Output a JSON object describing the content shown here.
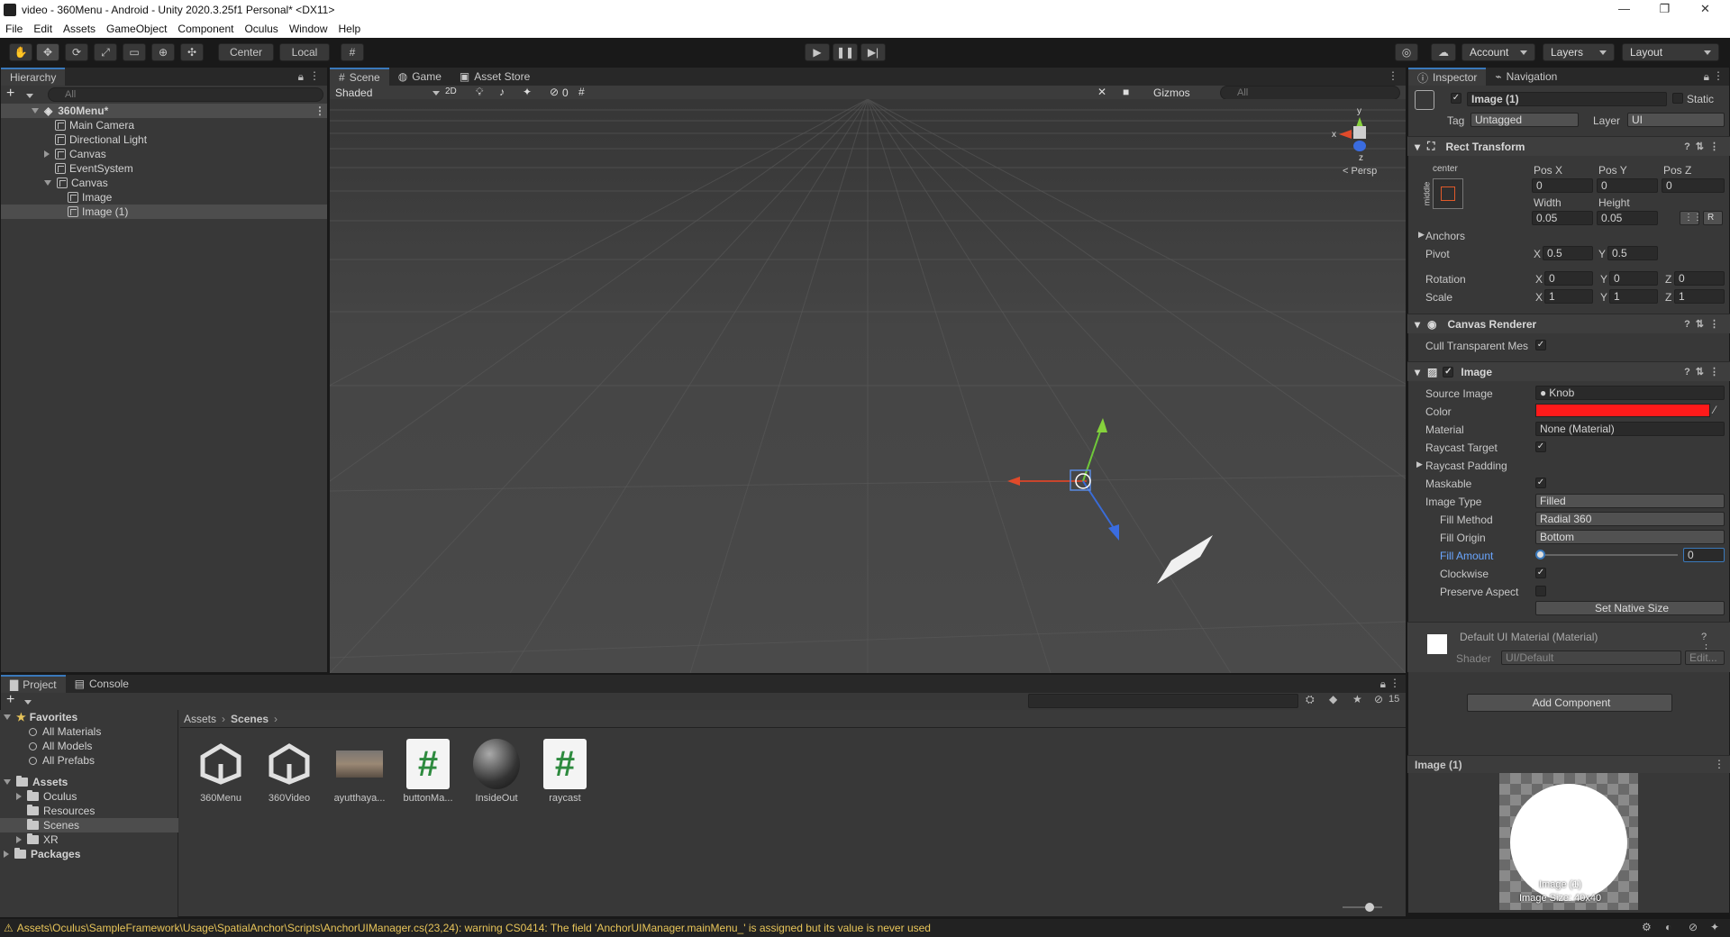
{
  "window": {
    "title": "video - 360Menu - Android - Unity 2020.3.25f1 Personal* <DX11>",
    "min": "—",
    "max": "❐",
    "close": "✕"
  },
  "menu": [
    "File",
    "Edit",
    "Assets",
    "GameObject",
    "Component",
    "Oculus",
    "Window",
    "Help"
  ],
  "toolbar": {
    "center_label": "Center",
    "local_label": "Local",
    "account_label": "Account",
    "layers_label": "Layers",
    "layout_label": "Layout"
  },
  "hierarchy": {
    "tab": "Hierarchy",
    "search_placeholder": "All",
    "add": "+",
    "scene": "360Menu*",
    "items": [
      "Main Camera",
      "Directional Light",
      "Canvas",
      "EventSystem",
      "Canvas",
      "Image",
      "Image (1)"
    ]
  },
  "scene": {
    "tabs": [
      "Scene",
      "Game",
      "Asset Store"
    ],
    "shading": "Shaded",
    "mode2d": "2D",
    "hidden_count": "0",
    "gizmos": "Gizmos",
    "search_placeholder": "All",
    "persp": "< Persp",
    "axis_x": "x",
    "axis_y": "y",
    "axis_z": "z"
  },
  "inspector": {
    "tabs": [
      "Inspector",
      "Navigation"
    ],
    "object_name": "Image (1)",
    "static_label": "Static",
    "tag_label": "Tag",
    "tag_value": "Untagged",
    "layer_label": "Layer",
    "layer_value": "UI",
    "rect": {
      "title": "Rect Transform",
      "anchor_h": "center",
      "anchor_v": "middle",
      "posx_label": "Pos X",
      "posy_label": "Pos Y",
      "posz_label": "Pos Z",
      "posx": "0",
      "posy": "0",
      "posz": "0",
      "width_label": "Width",
      "height_label": "Height",
      "width": "0.05",
      "height": "0.05",
      "anchors": "Anchors",
      "pivot": "Pivot",
      "pivot_x": "0.5",
      "pivot_y": "0.5",
      "rotation": "Rotation",
      "rot_x": "0",
      "rot_y": "0",
      "rot_z": "0",
      "scale": "Scale",
      "scale_x": "1",
      "scale_y": "1",
      "scale_z": "1",
      "x": "X",
      "y": "Y",
      "z": "Z",
      "r": "R"
    },
    "canvas_renderer": {
      "title": "Canvas Renderer",
      "cull_label": "Cull Transparent Mes",
      "check": "✓"
    },
    "image": {
      "title": "Image",
      "source_label": "Source Image",
      "source_value": "Knob",
      "color_label": "Color",
      "color": "#ff1a1a",
      "material_label": "Material",
      "material_value": "None (Material)",
      "raycast_label": "Raycast Target",
      "padding_label": "Raycast Padding",
      "maskable_label": "Maskable",
      "type_label": "Image Type",
      "type_value": "Filled",
      "method_label": "Fill Method",
      "method_value": "Radial 360",
      "origin_label": "Fill Origin",
      "origin_value": "Bottom",
      "amount_label": "Fill Amount",
      "amount_value": "0",
      "clockwise_label": "Clockwise",
      "preserve_label": "Preserve Aspect",
      "native_button": "Set Native Size"
    },
    "material": {
      "title": "Default UI Material (Material)",
      "shader_label": "Shader",
      "shader_value": "UI/Default",
      "edit": "Edit..."
    },
    "add_component": "Add Component",
    "preview": {
      "title": "Image (1)",
      "name": "Image (1)",
      "size": "Image Size: 40x40"
    }
  },
  "project": {
    "tabs": [
      "Project",
      "Console"
    ],
    "favorites": "Favorites",
    "fav_items": [
      "All Materials",
      "All Models",
      "All Prefabs"
    ],
    "assets_root": "Assets",
    "folders": [
      "Oculus",
      "Resources",
      "Scenes",
      "XR"
    ],
    "packages": "Packages",
    "breadcrumb": [
      "Assets",
      "Scenes"
    ],
    "files": [
      "360Menu",
      "360Video",
      "ayutthaya...",
      "buttonMa...",
      "InsideOut",
      "raycast"
    ],
    "hidden_count": "15"
  },
  "status": {
    "message": "Assets\\Oculus\\SampleFramework\\Usage\\SpatialAnchor\\Scripts\\AnchorUIManager.cs(23,24): warning CS0414: The field 'AnchorUIManager.mainMenu_' is assigned but its value is never used"
  },
  "colors": {
    "accent": "#3a79bb",
    "warning": "#e8c55a",
    "fill_color": "#ff1a1a"
  }
}
